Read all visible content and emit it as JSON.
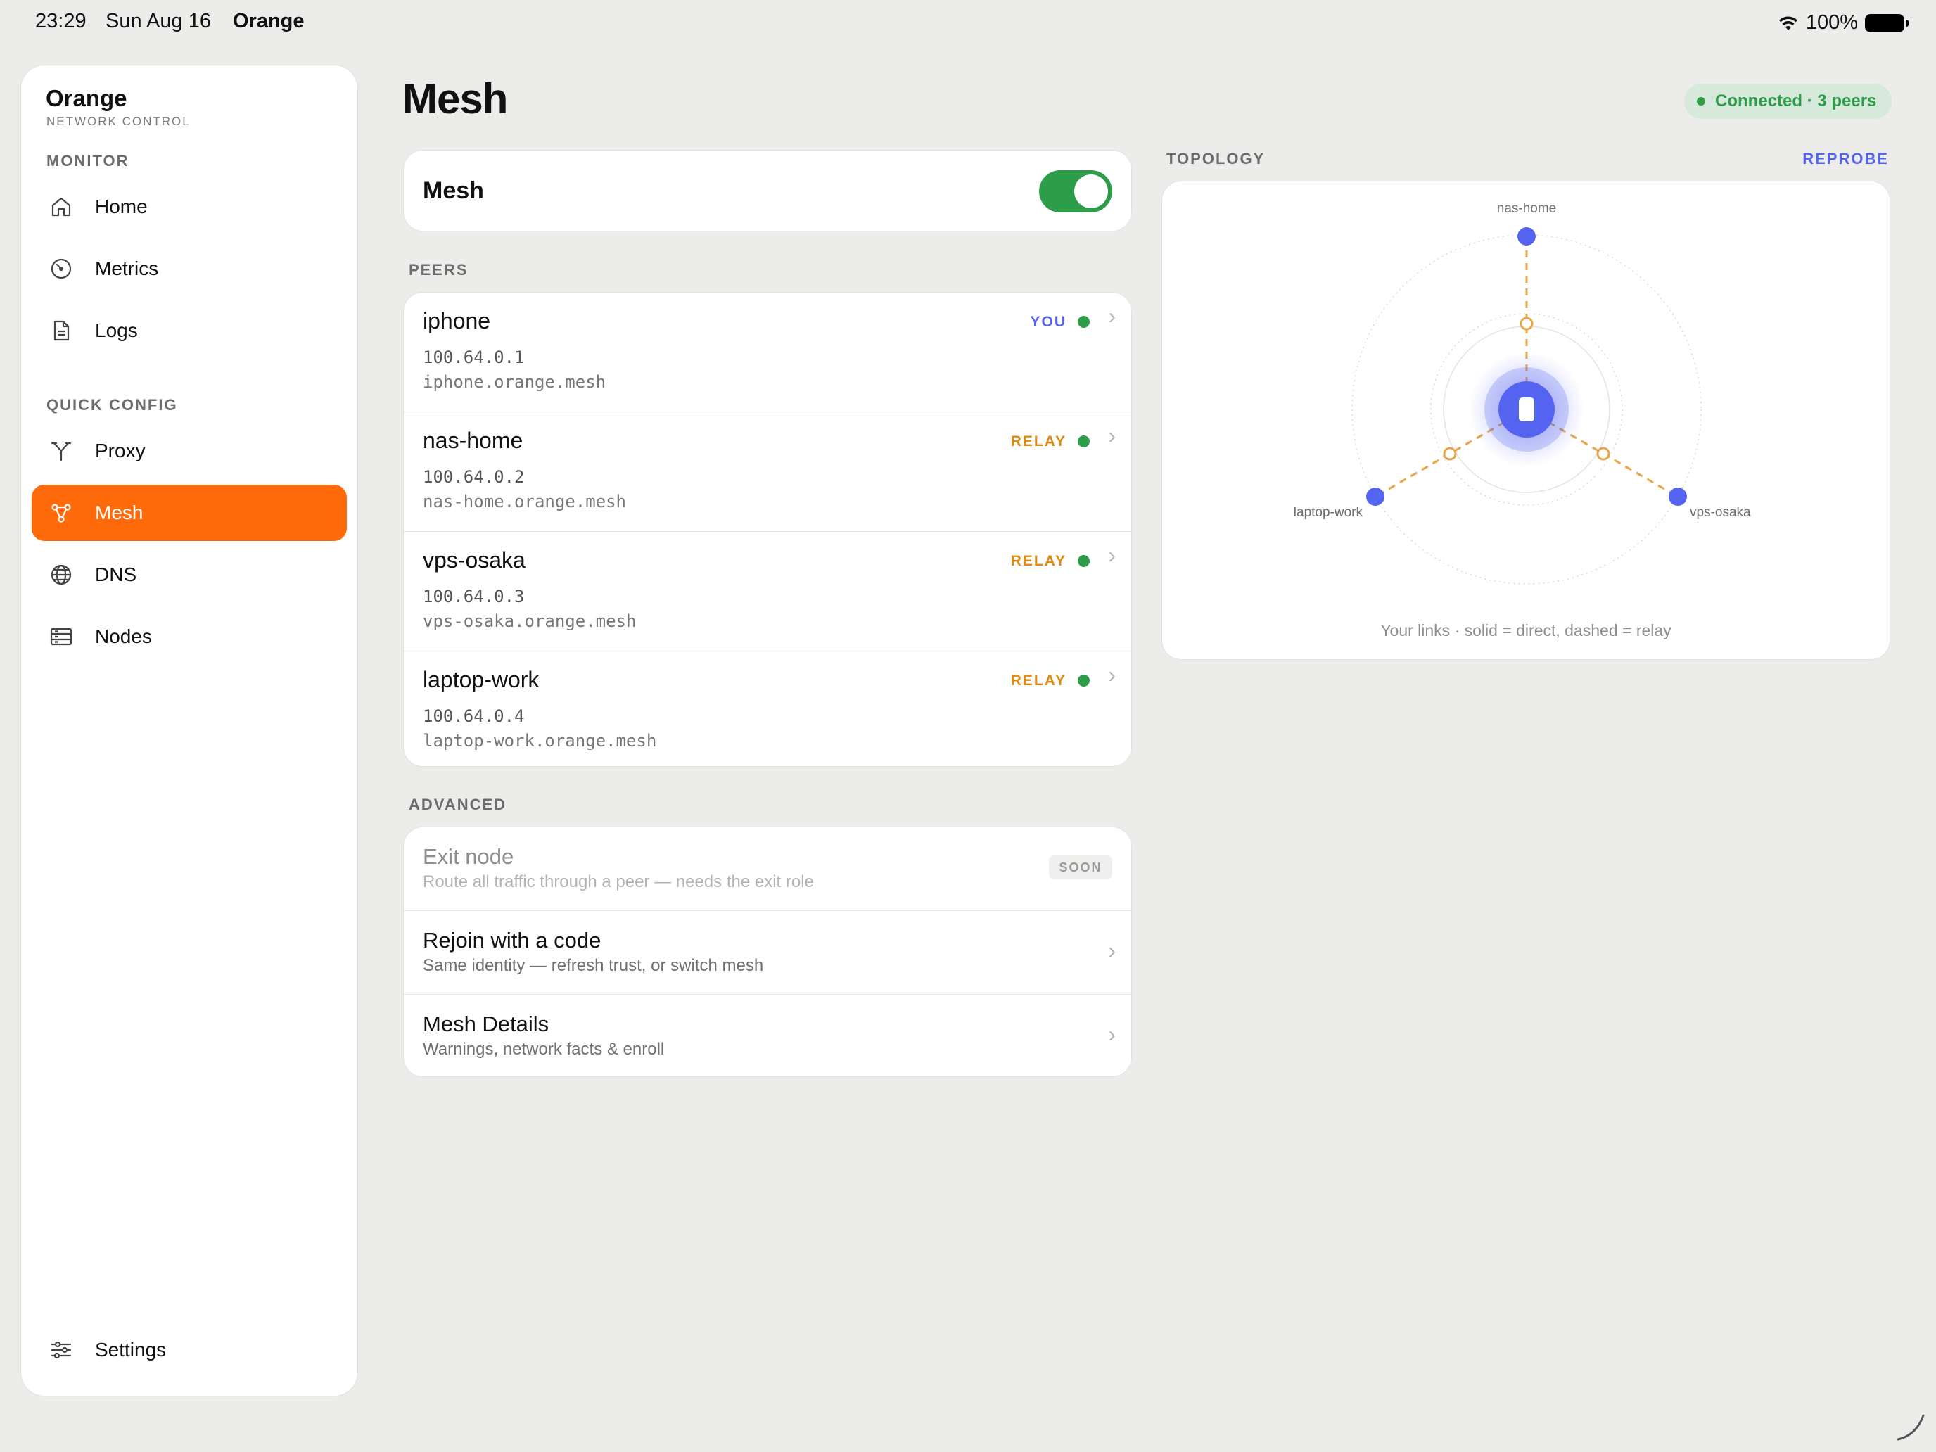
{
  "status_bar": {
    "time": "23:29",
    "date": "Sun Aug 16",
    "app": "Orange",
    "battery": "100%"
  },
  "sidebar": {
    "brand": "Orange",
    "brand_sub": "NETWORK CONTROL",
    "monitor_title": "MONITOR",
    "quick_config_title": "QUICK CONFIG",
    "items": [
      {
        "label": "Home",
        "icon": "home-icon"
      },
      {
        "label": "Metrics",
        "icon": "gauge-icon"
      },
      {
        "label": "Logs",
        "icon": "document-icon"
      },
      {
        "label": "Proxy",
        "icon": "fork-icon"
      },
      {
        "label": "Mesh",
        "icon": "mesh-icon",
        "active": true
      },
      {
        "label": "DNS",
        "icon": "globe-icon"
      },
      {
        "label": "Nodes",
        "icon": "server-icon"
      }
    ],
    "settings_label": "Settings"
  },
  "main": {
    "title": "Mesh",
    "connection_status": "Connected · 3 peers",
    "mesh_toggle": {
      "label": "Mesh",
      "on": true
    },
    "peers_title": "PEERS",
    "peers": [
      {
        "name": "iphone",
        "ip": "100.64.0.1",
        "dns": "iphone.orange.mesh",
        "tag": "YOU",
        "tag_color": "#5564F0"
      },
      {
        "name": "nas-home",
        "ip": "100.64.0.2",
        "dns": "nas-home.orange.mesh",
        "tag": "RELAY",
        "tag_color": "#E08A12"
      },
      {
        "name": "vps-osaka",
        "ip": "100.64.0.3",
        "dns": "vps-osaka.orange.mesh",
        "tag": "RELAY",
        "tag_color": "#E08A12"
      },
      {
        "name": "laptop-work",
        "ip": "100.64.0.4",
        "dns": "laptop-work.orange.mesh",
        "tag": "RELAY",
        "tag_color": "#E08A12"
      }
    ],
    "advanced_title": "ADVANCED",
    "advanced": [
      {
        "title": "Exit node",
        "subtitle": "Route all traffic through a peer — needs the exit role",
        "badge": "SOON",
        "disabled": true
      },
      {
        "title": "Rejoin with a code",
        "subtitle": "Same identity — refresh trust, or switch mesh"
      },
      {
        "title": "Mesh Details",
        "subtitle": "Warnings, network facts & enroll"
      }
    ]
  },
  "topology": {
    "title": "TOPOLOGY",
    "action": "REPROBE",
    "nodes": [
      "nas-home",
      "laptop-work",
      "vps-osaka"
    ],
    "caption": "Your links · solid = direct, dashed = relay",
    "link_color": "#E8A64A",
    "node_color": "#5564F0"
  },
  "colors": {
    "accent": "#FF6B0A",
    "success": "#2E9D4A",
    "link": "#5564F0",
    "relay": "#E08A12"
  }
}
